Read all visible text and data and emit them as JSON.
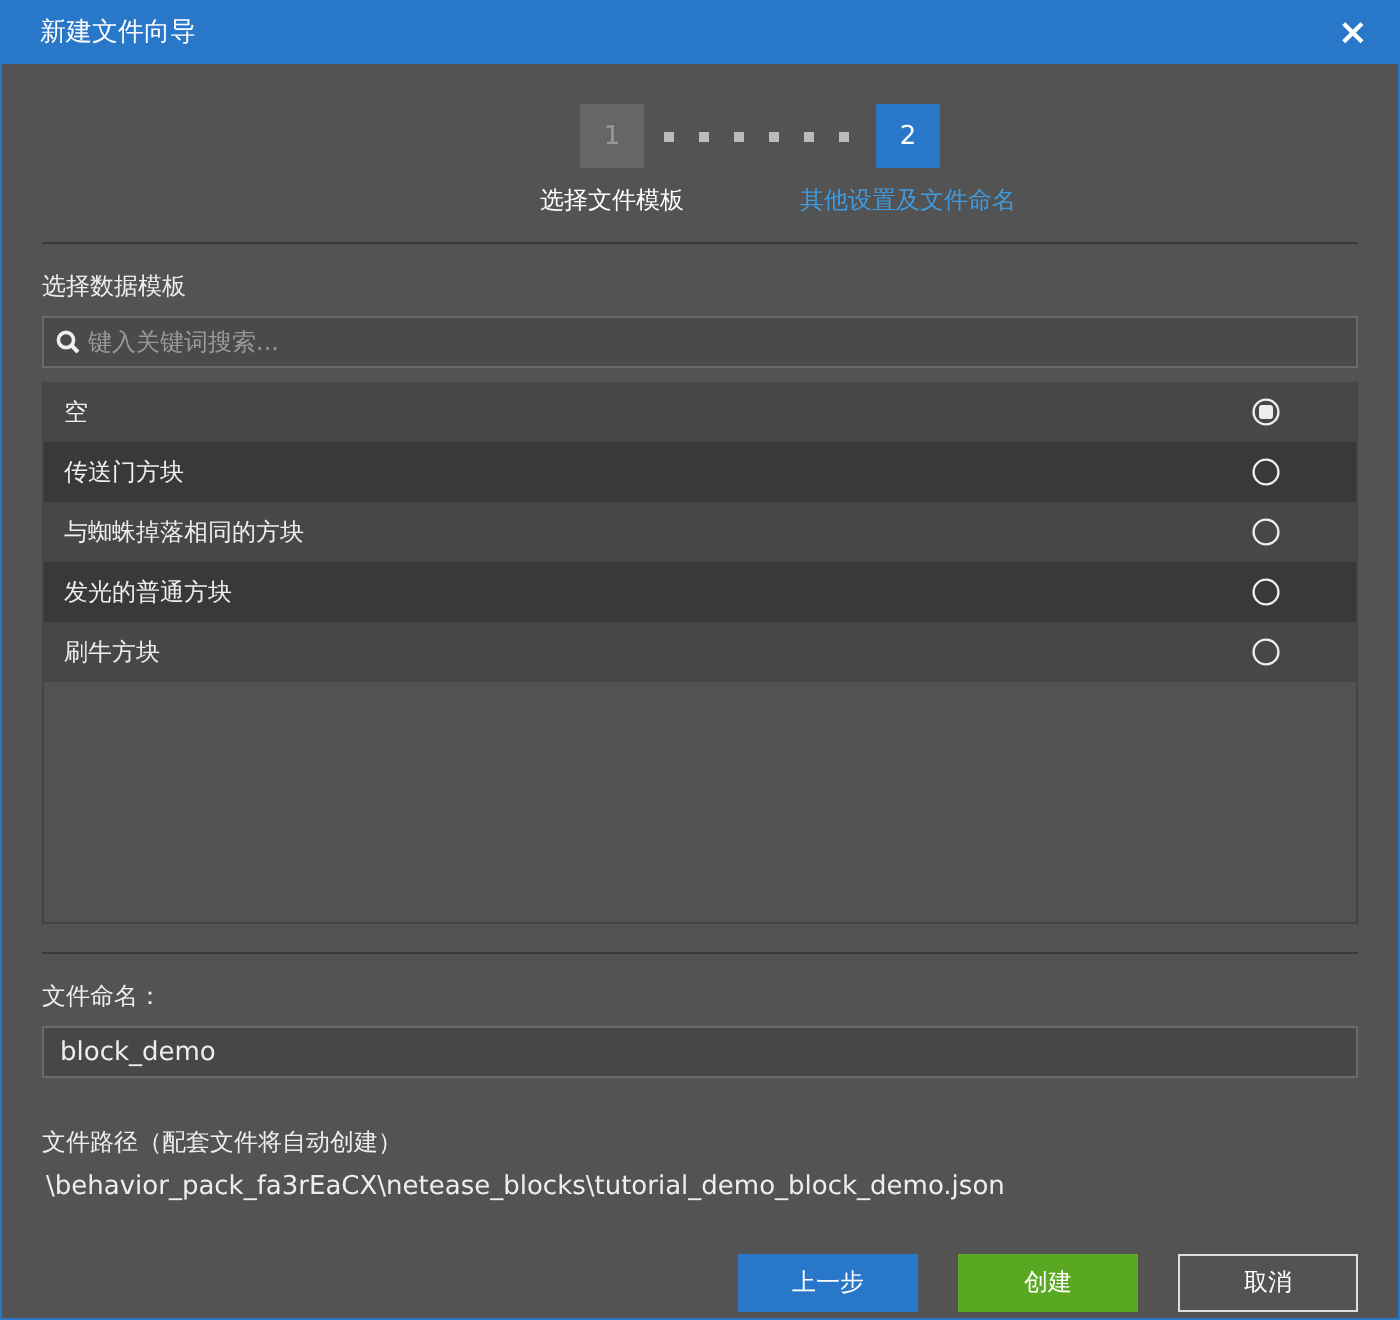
{
  "window": {
    "title": "新建文件向导",
    "close": "×"
  },
  "steps": [
    {
      "number": "1",
      "label": "选择文件模板",
      "selected": false
    },
    {
      "number": "2",
      "label": "其他设置及文件命名",
      "selected": true
    }
  ],
  "template_section": {
    "label": "选择数据模板",
    "search": {
      "placeholder": "键入关键词搜索..."
    },
    "items": [
      {
        "label": "空",
        "selected": true
      },
      {
        "label": "传送门方块",
        "selected": false
      },
      {
        "label": "与蜘蛛掉落相同的方块",
        "selected": false
      },
      {
        "label": "发光的普通方块",
        "selected": false
      },
      {
        "label": "刷牛方块",
        "selected": false
      }
    ]
  },
  "file_name": {
    "label": "文件命名：",
    "value": "block_demo"
  },
  "file_path": {
    "label": "文件路径（配套文件将自动创建）",
    "value": "\\behavior_pack_fa3rEaCX\\netease_blocks\\tutorial_demo_block_demo.json"
  },
  "buttons": [
    {
      "label": "上一步",
      "kind": "secondary"
    },
    {
      "label": "创建",
      "kind": "primary"
    },
    {
      "label": "取消",
      "kind": "outline"
    }
  ]
}
